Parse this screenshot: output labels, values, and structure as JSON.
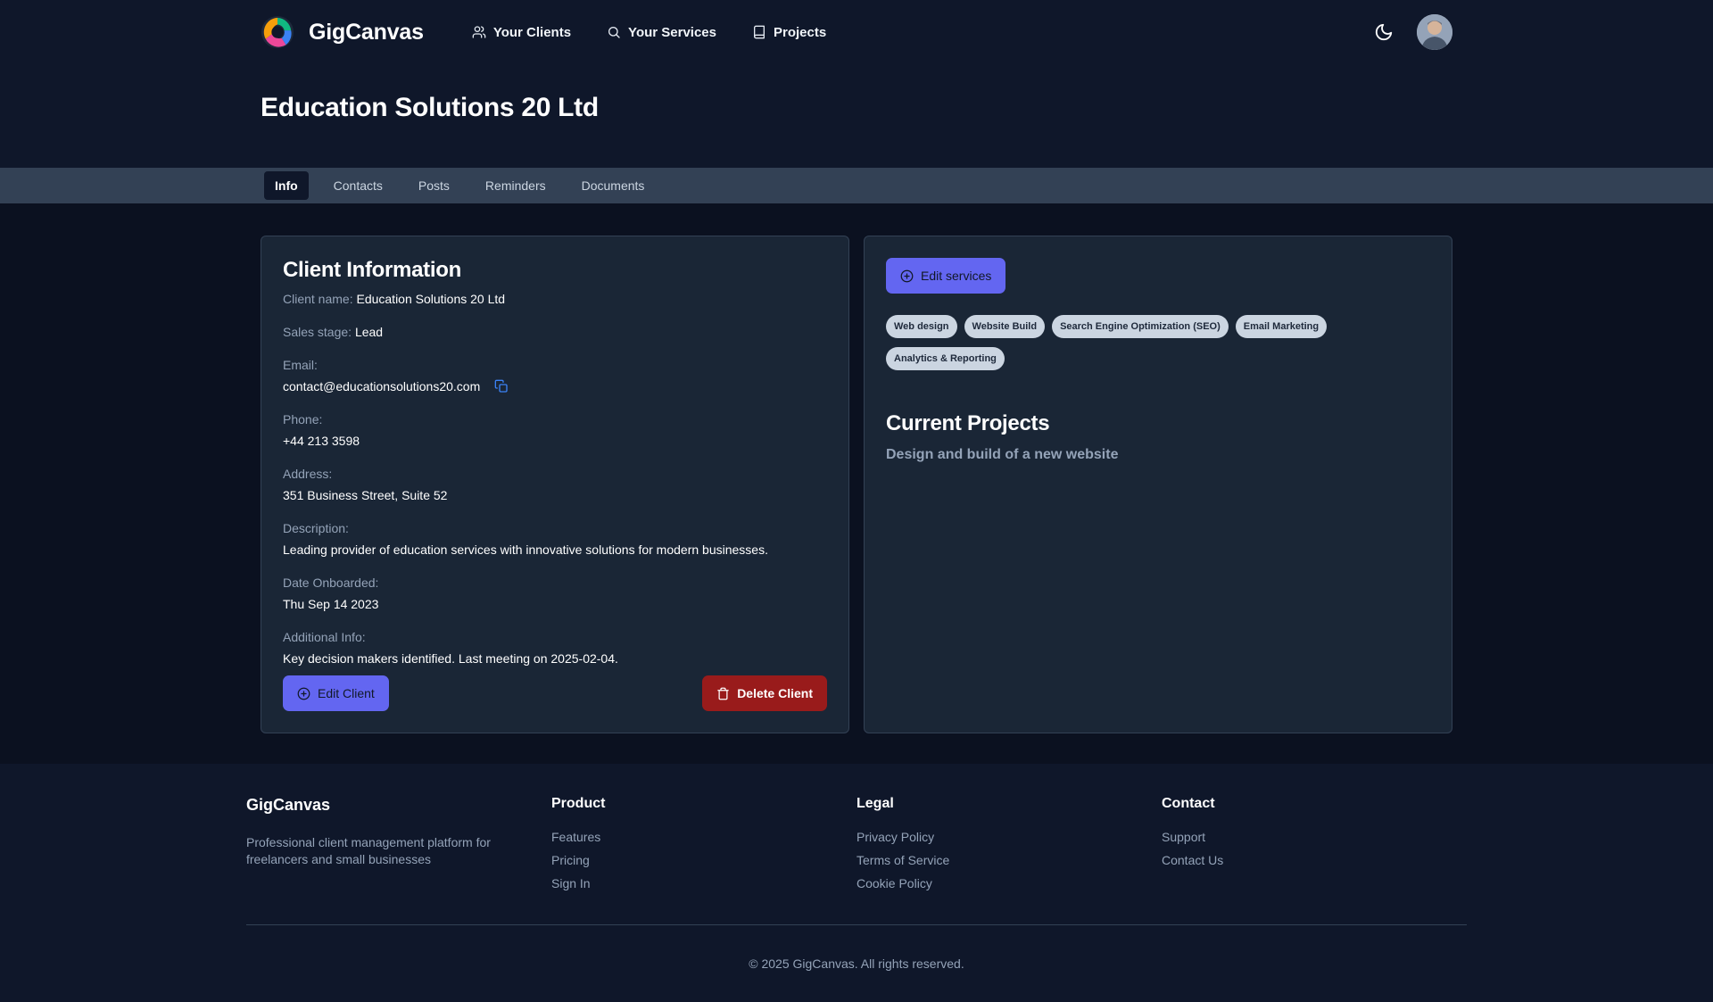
{
  "app": {
    "brand": "GigCanvas",
    "colors": {
      "accent": "#6366f1",
      "danger": "#991b1b",
      "background": "#0f172a"
    }
  },
  "nav": {
    "links": [
      {
        "label": "Your Clients",
        "icon": "users-icon"
      },
      {
        "label": "Your Services",
        "icon": "search-icon"
      },
      {
        "label": "Projects",
        "icon": "book-icon"
      }
    ],
    "theme_icon": "moon-icon"
  },
  "page": {
    "title": "Education Solutions 20 Ltd"
  },
  "tabs": [
    {
      "label": "Info",
      "active": true
    },
    {
      "label": "Contacts",
      "active": false
    },
    {
      "label": "Posts",
      "active": false
    },
    {
      "label": "Reminders",
      "active": false
    },
    {
      "label": "Documents",
      "active": false
    }
  ],
  "client": {
    "section_title": "Client Information",
    "name_label": "Client name:",
    "name": "Education Solutions 20 Ltd",
    "stage_label": "Sales stage:",
    "stage": "Lead",
    "email_label": "Email:",
    "email": "contact@educationsolutions20.com",
    "phone_label": "Phone:",
    "phone": "+44 213 3598",
    "address_label": "Address:",
    "address": "351 Business Street, Suite 52",
    "description_label": "Description:",
    "description": "Leading provider of education services with innovative solutions for modern businesses.",
    "onboarded_label": "Date Onboarded:",
    "onboarded": "Thu Sep 14 2023",
    "additional_label": "Additional Info:",
    "additional": "Key decision makers identified. Last meeting on 2025-02-04.",
    "edit_label": "Edit Client",
    "delete_label": "Delete Client"
  },
  "services": {
    "edit_label": "Edit services",
    "tags": [
      "Web design",
      "Website Build",
      "Search Engine Optimization (SEO)",
      "Email Marketing",
      "Analytics & Reporting"
    ]
  },
  "projects": {
    "title": "Current Projects",
    "items": [
      "Design and build of a new website"
    ]
  },
  "footer": {
    "brand": "GigCanvas",
    "description": "Professional client management platform for freelancers and small businesses",
    "product": {
      "heading": "Product",
      "links": [
        "Features",
        "Pricing",
        "Sign In"
      ]
    },
    "legal": {
      "heading": "Legal",
      "links": [
        "Privacy Policy",
        "Terms of Service",
        "Cookie Policy"
      ]
    },
    "contact": {
      "heading": "Contact",
      "links": [
        "Support",
        "Contact Us"
      ]
    },
    "copyright": "© 2025 GigCanvas. All rights reserved."
  }
}
